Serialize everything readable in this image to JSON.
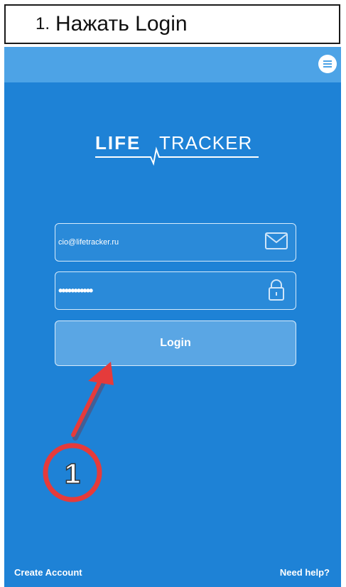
{
  "caption": {
    "number": "1.",
    "text": "Нажать Login"
  },
  "app": {
    "logo": {
      "left_word": "LIFE",
      "right_word": "TRACKER"
    },
    "email_value": "cio@lifetracker.ru",
    "password_value": "•••••••••••",
    "login_label": "Login",
    "create_account_label": "Create Account",
    "need_help_label": "Need help?",
    "annotation_number": "1"
  },
  "icons": {
    "menu": "menu-icon",
    "email": "envelope-icon",
    "password": "lock-icon",
    "annotation": "red-arrow"
  },
  "colors": {
    "background": "#1e82d6",
    "topbar": "#4da3e6",
    "annotation": "#e53b3b"
  }
}
